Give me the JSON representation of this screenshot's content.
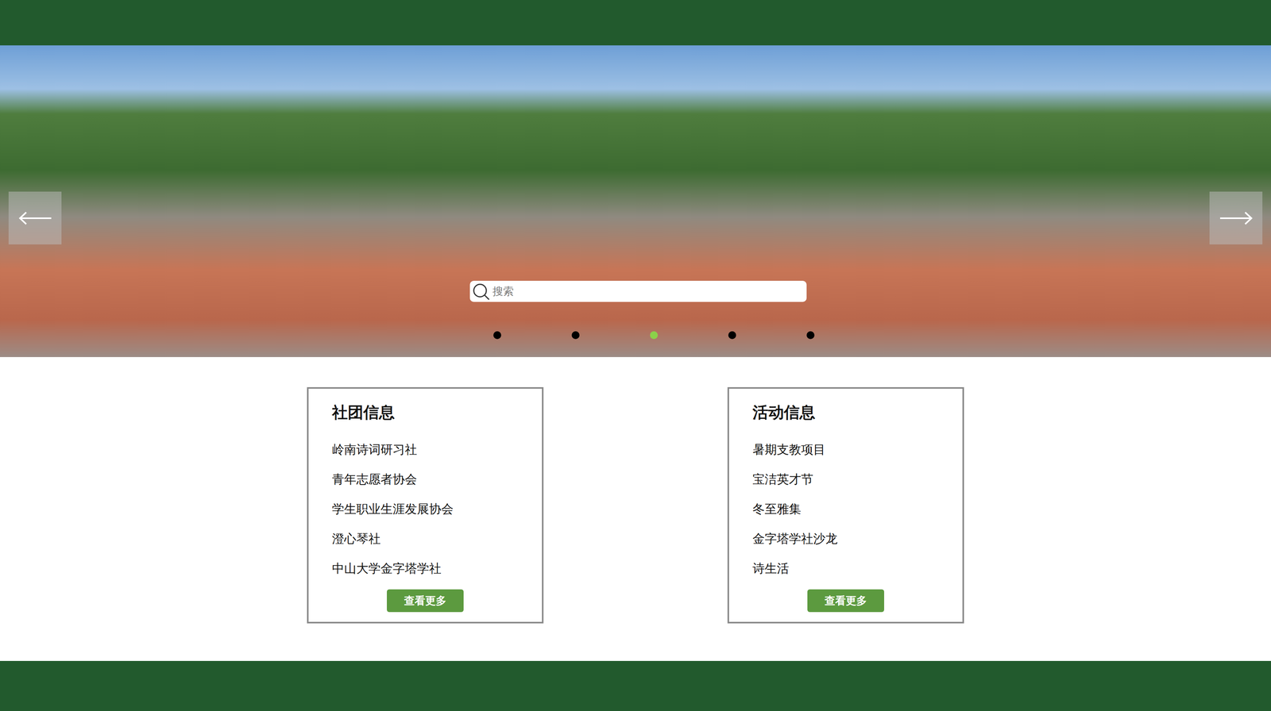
{
  "carousel": {
    "search": {
      "placeholder": "搜索"
    },
    "indicators": [
      {
        "selected": false
      },
      {
        "selected": false
      },
      {
        "selected": true
      },
      {
        "selected": false
      },
      {
        "selected": false
      }
    ]
  },
  "sections": [
    {
      "title": "社团信息",
      "items": [
        "岭南诗词研习社",
        "青年志愿者协会",
        "学生职业生涯发展协会",
        "澄心琴社",
        "中山大学金字塔学社"
      ],
      "button": "查看更多"
    },
    {
      "title": "活动信息",
      "items": [
        "暑期支教项目",
        "宝洁英才节",
        "冬至雅集",
        "金字塔学社沙龙",
        "诗生活"
      ],
      "button": "查看更多"
    }
  ]
}
